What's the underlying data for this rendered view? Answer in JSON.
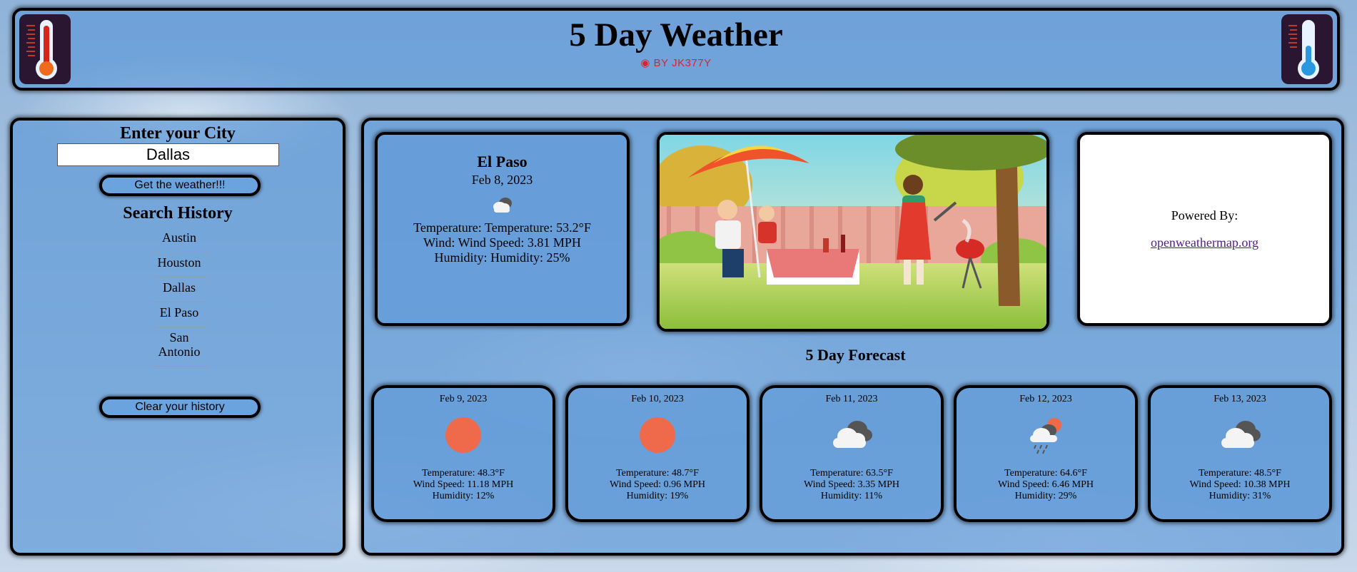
{
  "header": {
    "title": "5 Day Weather",
    "byline": "BY JK377Y"
  },
  "sidebar": {
    "heading": "Enter your City",
    "input_value": "Dallas",
    "get_button": "Get the weather!!!",
    "history_heading": "Search History",
    "history": [
      "Austin",
      "Houston",
      "Dallas",
      "El Paso",
      "San Antonio"
    ],
    "clear_button": "Clear your history"
  },
  "current": {
    "city": "El Paso",
    "date": "Feb 8, 2023",
    "icon": "cloud-icon",
    "temperature": "Temperature: Temperature: 53.2°F",
    "wind": "Wind: Wind Speed: 3.81 MPH",
    "humidity": "Humidity: Humidity: 25%"
  },
  "powered": {
    "label": "Powered By:",
    "link": "openweathermap.org"
  },
  "forecast_heading": "5 Day Forecast",
  "forecast": [
    {
      "date": "Feb 9, 2023",
      "icon": "sun-icon",
      "temp": "Temperature: 48.3°F",
      "wind": "Wind Speed: 11.18 MPH",
      "humidity": "Humidity: 12%"
    },
    {
      "date": "Feb 10, 2023",
      "icon": "sun-icon",
      "temp": "Temperature: 48.7°F",
      "wind": "Wind Speed: 0.96 MPH",
      "humidity": "Humidity: 19%"
    },
    {
      "date": "Feb 11, 2023",
      "icon": "cloud-icon",
      "temp": "Temperature: 63.5°F",
      "wind": "Wind Speed: 3.35 MPH",
      "humidity": "Humidity: 11%"
    },
    {
      "date": "Feb 12, 2023",
      "icon": "rain-icon",
      "temp": "Temperature: 64.6°F",
      "wind": "Wind Speed: 6.46 MPH",
      "humidity": "Humidity: 29%"
    },
    {
      "date": "Feb 13, 2023",
      "icon": "cloud-icon",
      "temp": "Temperature: 48.5°F",
      "wind": "Wind Speed: 10.38 MPH",
      "humidity": "Humidity: 31%"
    }
  ],
  "colors": {
    "panel": "#639bd8",
    "sun": "#ee6a4a",
    "byline": "#d8242f"
  }
}
